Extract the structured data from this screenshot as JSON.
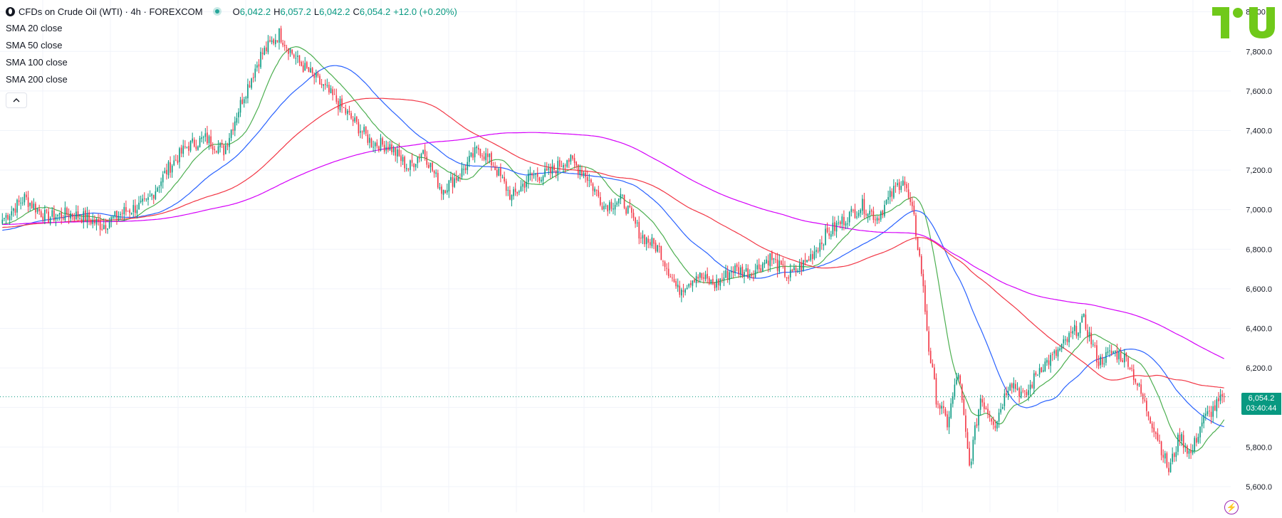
{
  "header": {
    "symbol_icon": "crude-oil-drop-icon",
    "title": "CFDs on Crude Oil (WTI) · 4h · FOREXCOM",
    "ohlc": [
      {
        "k": "O",
        "v": "6,042.2"
      },
      {
        "k": "H",
        "v": "6,057.2"
      },
      {
        "k": "L",
        "v": "6,042.2"
      },
      {
        "k": "C",
        "v": "6,054.2"
      }
    ],
    "change": "+12.0 (+0.20%)",
    "collapse_icon": "chevron-up-icon"
  },
  "indicators": [
    {
      "label": "SMA 20 close",
      "color": "#4caf50"
    },
    {
      "label": "SMA 50 close",
      "color": "#2962ff"
    },
    {
      "label": "SMA 100 close",
      "color": "#f23645"
    },
    {
      "label": "SMA 200 close",
      "color": "#d500f9"
    }
  ],
  "colors": {
    "up": "#089981",
    "down": "#f23645",
    "grid": "#f0f3fa",
    "axis_text": "#131722"
  },
  "last_price": {
    "value": "6,054.2",
    "countdown": "03:40:44"
  },
  "logo": {
    "icon": "tradingview-logo-icon",
    "color": "#70c91a"
  },
  "bottom_icon": "lightning-bolt-icon",
  "chart_data": {
    "type": "candlestick",
    "title": "CFDs on Crude Oil (WTI)",
    "interval": "4h",
    "y_ticks": [
      5600,
      5800,
      6000,
      6200,
      6400,
      6600,
      6800,
      7000,
      7200,
      7400,
      7600,
      7800,
      8000
    ],
    "y_tick_labels": [
      "5,600.0",
      "5,800.0",
      "6,000.0",
      "6,200.0",
      "6,400.0",
      "6,600.0",
      "6,800.0",
      "7,000.0",
      "7,200.0",
      "7,400.0",
      "7,600.0",
      "7,800.0",
      "8,000.0"
    ],
    "ylim": [
      5470,
      8060
    ],
    "grid": true,
    "last_close": 6054.2,
    "close_path": [
      [
        0,
        6950
      ],
      [
        12,
        7060
      ],
      [
        24,
        6960
      ],
      [
        36,
        6980
      ],
      [
        45,
        6960
      ],
      [
        54,
        6920
      ],
      [
        66,
        6990
      ],
      [
        78,
        7030
      ],
      [
        90,
        7210
      ],
      [
        100,
        7320
      ],
      [
        110,
        7360
      ],
      [
        120,
        7300
      ],
      [
        130,
        7560
      ],
      [
        140,
        7780
      ],
      [
        150,
        7890
      ],
      [
        160,
        7750
      ],
      [
        170,
        7660
      ],
      [
        180,
        7560
      ],
      [
        190,
        7450
      ],
      [
        200,
        7340
      ],
      [
        210,
        7320
      ],
      [
        220,
        7210
      ],
      [
        228,
        7300
      ],
      [
        238,
        7100
      ],
      [
        248,
        7180
      ],
      [
        258,
        7310
      ],
      [
        266,
        7230
      ],
      [
        276,
        7060
      ],
      [
        286,
        7170
      ],
      [
        296,
        7180
      ],
      [
        306,
        7260
      ],
      [
        316,
        7180
      ],
      [
        326,
        7020
      ],
      [
        336,
        7050
      ],
      [
        346,
        6870
      ],
      [
        356,
        6800
      ],
      [
        366,
        6590
      ],
      [
        376,
        6670
      ],
      [
        386,
        6620
      ],
      [
        396,
        6700
      ],
      [
        406,
        6680
      ],
      [
        416,
        6760
      ],
      [
        426,
        6660
      ],
      [
        436,
        6740
      ],
      [
        446,
        6870
      ],
      [
        456,
        6950
      ],
      [
        466,
        7020
      ],
      [
        474,
        6960
      ],
      [
        482,
        7080
      ],
      [
        488,
        7160
      ],
      [
        494,
        6950
      ],
      [
        498,
        6690
      ],
      [
        502,
        6300
      ],
      [
        506,
        6050
      ],
      [
        512,
        5920
      ],
      [
        518,
        6180
      ],
      [
        524,
        5700
      ],
      [
        530,
        6050
      ],
      [
        538,
        5920
      ],
      [
        546,
        6140
      ],
      [
        554,
        6050
      ],
      [
        562,
        6200
      ],
      [
        570,
        6260
      ],
      [
        578,
        6350
      ],
      [
        586,
        6440
      ],
      [
        594,
        6230
      ],
      [
        602,
        6280
      ],
      [
        610,
        6240
      ],
      [
        618,
        6040
      ],
      [
        626,
        5850
      ],
      [
        632,
        5680
      ],
      [
        638,
        5860
      ],
      [
        644,
        5760
      ],
      [
        650,
        5930
      ],
      [
        656,
        5990
      ],
      [
        662,
        6054
      ]
    ],
    "sma_series": [
      {
        "name": "SMA 20 close",
        "period": 20,
        "color": "#4caf50"
      },
      {
        "name": "SMA 50 close",
        "period": 50,
        "color": "#2962ff"
      },
      {
        "name": "SMA 100 close",
        "period": 100,
        "color": "#f23645"
      },
      {
        "name": "SMA 200 close",
        "period": 200,
        "color": "#d500f9"
      }
    ],
    "sma_start": {
      "20": 6925,
      "50": 6895,
      "100": 6910,
      "200": 6925
    },
    "sma_last": {
      "20": 5900,
      "50": 5850,
      "100": 6060,
      "200": 6300
    }
  }
}
